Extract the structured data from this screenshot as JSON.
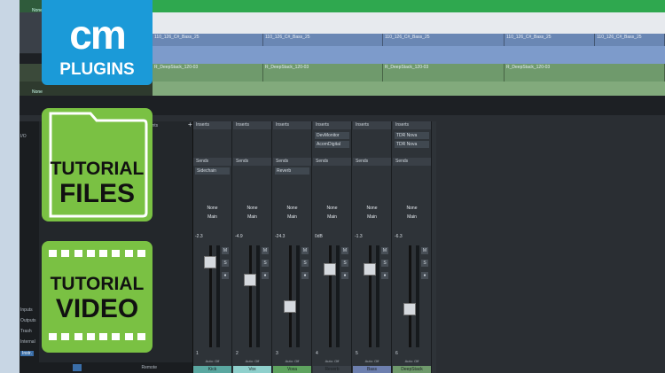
{
  "badges": {
    "cm_main": "cm",
    "cm_sub": "PLUGINS",
    "files_line1": "TUTORIAL",
    "files_line2": "FILES",
    "video_line1": "TUTORIAL",
    "video_line2": "VIDEO"
  },
  "colors": {
    "cm_blue": "#1b9ad8",
    "badge_green": "#7ac143",
    "daw_bg": "#2a2e33"
  },
  "arrange": {
    "tracks": [
      {
        "label": "None",
        "lane_clips": [],
        "style": "green"
      },
      {
        "label": "",
        "lane_clips": [],
        "style": "white"
      },
      {
        "label": "",
        "lane_clips": [
          "110_126_C#_Bass_25",
          "110_126_C#_Bass_25",
          "110_126_C#_Bass_25",
          "110_126_C#_Bass_25",
          "110_126_C#_Bass_25"
        ],
        "style": "blue"
      },
      {
        "label": "",
        "lane_clips": [
          "R_DeepStack_120-03",
          "R_DeepStack_120-03",
          "R_DeepStack_120-03",
          "R_DeepStack_120-03"
        ],
        "style": "sage"
      },
      {
        "label": "None",
        "lane_clips": [],
        "style": "sage2"
      }
    ]
  },
  "browser": {
    "tab": "Instruments",
    "side_items": [
      "I/O",
      "Inputs",
      "Outputs",
      "Trash",
      "Internal",
      "Instr."
    ],
    "footer": "Remote"
  },
  "mixer": {
    "strips": [
      {
        "num": "1",
        "db": "-2.3",
        "name": "Kick",
        "name_bg": "#5aa7a0",
        "inserts": [],
        "sends": [
          "Sidechain"
        ],
        "route1": "None",
        "route2": "Main"
      },
      {
        "num": "2",
        "db": "-4.9",
        "name": "Vox",
        "name_bg": "#8fd0cc",
        "inserts": [],
        "sends": [],
        "route1": "None",
        "route2": "Main"
      },
      {
        "num": "3",
        "db": "-24.3",
        "name": "Voxa",
        "name_bg": "#5ea35f",
        "inserts": [],
        "sends": [
          "Reverb"
        ],
        "route1": "None",
        "route2": "Main"
      },
      {
        "num": "4",
        "db": "0dB",
        "name": "Reverb",
        "name_bg": "#3a4047",
        "inserts": [
          "DevMonitor",
          "AcornDigital"
        ],
        "sends": [],
        "route1": "None",
        "route2": "Main"
      },
      {
        "num": "5",
        "db": "-1.3",
        "name": "Bass",
        "name_bg": "#6d7fae",
        "inserts": [],
        "sends": [],
        "route1": "None",
        "route2": "Main"
      },
      {
        "num": "6",
        "db": "-6.3",
        "name": "DeepStack",
        "name_bg": "#6f9a6c",
        "inserts": [
          "TDR Nova",
          "TDR Nova"
        ],
        "sends": [],
        "route1": "None",
        "route2": "Main"
      }
    ],
    "inserts_label": "Inserts",
    "sends_label": "Sends",
    "auto_label": "Auto: Off",
    "fx_label": "FX"
  }
}
